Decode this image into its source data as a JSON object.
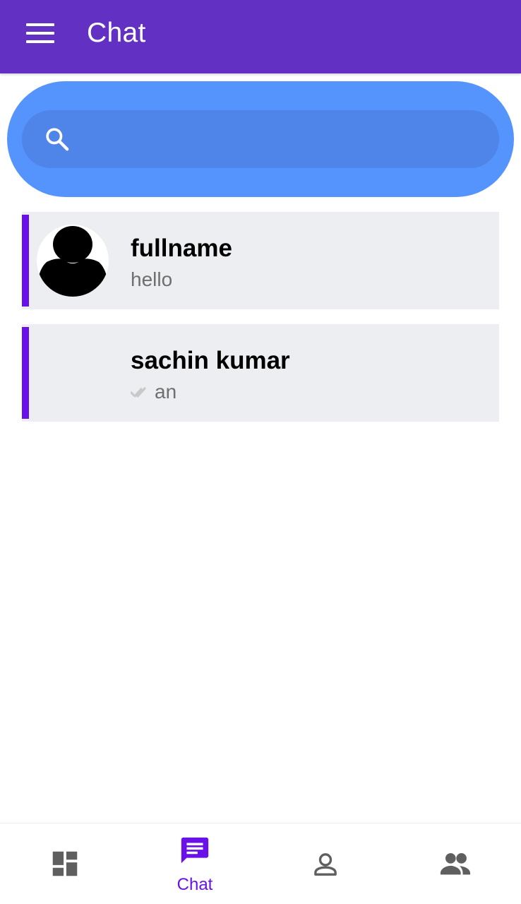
{
  "appbar": {
    "title": "Chat",
    "menu_icon": "hamburger-menu-icon",
    "color": "#6330c4"
  },
  "search": {
    "placeholder": "",
    "value": "",
    "icon": "search-icon",
    "outer_color": "#5594fc",
    "inner_color": "#4f84e8"
  },
  "chats": [
    {
      "name": "fullname",
      "last_message": "hello",
      "avatar": "default-user-avatar",
      "read_receipt": false
    },
    {
      "name": "sachin kumar",
      "last_message": "an",
      "avatar": "",
      "read_receipt": true
    }
  ],
  "accent_color": "#6a11ea",
  "bottom_nav": {
    "items": [
      {
        "id": "dashboard",
        "label": "",
        "icon": "dashboard-icon",
        "active": false
      },
      {
        "id": "chat",
        "label": "Chat",
        "icon": "chat-icon",
        "active": true
      },
      {
        "id": "profile",
        "label": "",
        "icon": "person-icon",
        "active": false
      },
      {
        "id": "groups",
        "label": "",
        "icon": "people-icon",
        "active": false
      }
    ],
    "active_color": "#6a11ea",
    "inactive_color": "#5f5f5f"
  }
}
